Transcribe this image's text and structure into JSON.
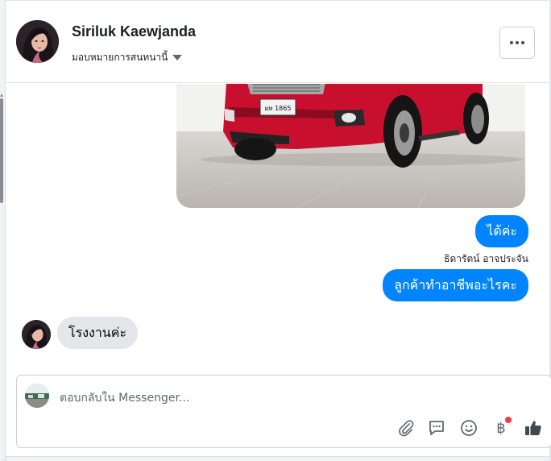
{
  "header": {
    "contact_name": "Siriluk Kaewjanda",
    "assign_label": "มอบหมายการสนทนานี้",
    "more_label": "More options"
  },
  "conversation": {
    "photo": {
      "plate_text": "ผห 1865",
      "car_color": "#c8102e"
    },
    "messages": [
      {
        "direction": "outgoing",
        "text": "ได้ค่ะ"
      },
      {
        "direction": "outgoing",
        "sender": "ธิดารัตน์ อาจประจัน",
        "text": "ลูกค้าทำอาชีพอะไรคะ"
      },
      {
        "direction": "incoming",
        "text": "โรงงานค่ะ"
      }
    ]
  },
  "composer": {
    "placeholder": "ตอบกลับใน Messenger...",
    "value": "",
    "tools": [
      "attachment-icon",
      "saved-reply-icon",
      "emoji-icon",
      "baht-payment-icon",
      "like-icon"
    ],
    "baht_symbol": "฿"
  },
  "colors": {
    "accent": "#0084ff",
    "incoming_bubble": "#e4e6eb",
    "notification": "#fa383e"
  }
}
